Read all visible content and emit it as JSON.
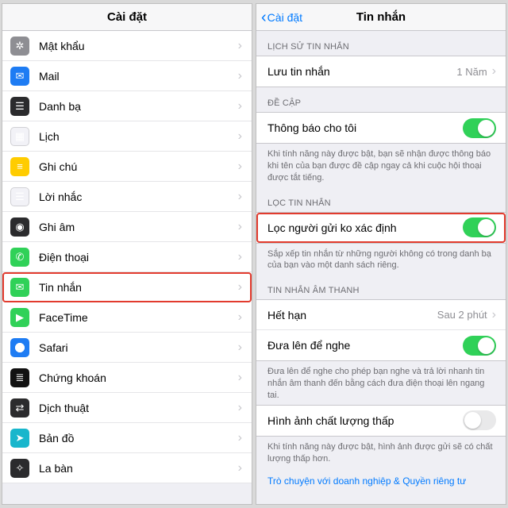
{
  "left": {
    "title": "Cài đặt",
    "items": [
      {
        "label": "Mật khẩu",
        "icon": "key-icon",
        "cls": "ic-gray"
      },
      {
        "label": "Mail",
        "icon": "mail-icon",
        "cls": "ic-blue"
      },
      {
        "label": "Danh bạ",
        "icon": "contacts-icon",
        "cls": "ic-dark"
      },
      {
        "label": "Lịch",
        "icon": "calendar-icon",
        "cls": "ic-white"
      },
      {
        "label": "Ghi chú",
        "icon": "notes-icon",
        "cls": "ic-yellow"
      },
      {
        "label": "Lời nhắc",
        "icon": "reminders-icon",
        "cls": "ic-white"
      },
      {
        "label": "Ghi âm",
        "icon": "voice-memos-icon",
        "cls": "ic-dark"
      },
      {
        "label": "Điện thoại",
        "icon": "phone-icon",
        "cls": "ic-green"
      },
      {
        "label": "Tin nhắn",
        "icon": "messages-icon",
        "cls": "ic-green",
        "highlight": true
      },
      {
        "label": "FaceTime",
        "icon": "facetime-icon",
        "cls": "ic-green"
      },
      {
        "label": "Safari",
        "icon": "safari-icon",
        "cls": "ic-compass"
      },
      {
        "label": "Chứng khoán",
        "icon": "stocks-icon",
        "cls": "ic-stock"
      },
      {
        "label": "Dịch thuật",
        "icon": "translate-icon",
        "cls": "ic-dark"
      },
      {
        "label": "Bản đồ",
        "icon": "maps-icon",
        "cls": "ic-teal"
      },
      {
        "label": "La bàn",
        "icon": "compass-icon",
        "cls": "ic-dark"
      }
    ]
  },
  "right": {
    "back": "Cài đặt",
    "title": "Tin nhắn",
    "history_header": "LỊCH SỬ TIN NHẮN",
    "keep_label": "Lưu tin nhắn",
    "keep_value": "1 Năm",
    "mention_header": "ĐỀ CẬP",
    "notify_label": "Thông báo cho tôi",
    "notify_footer": "Khi tính năng này được bật, bạn sẽ nhận được thông báo khi tên của bạn được đề cập ngay cả khi cuộc hội thoại được tắt tiếng.",
    "filter_header": "LỌC TIN NHẮN",
    "filter_label": "Lọc người gửi ko xác định",
    "filter_footer": "Sắp xếp tin nhắn từ những người không có trong danh bạ của bạn vào một danh sách riêng.",
    "audio_header": "TIN NHẮN ÂM THANH",
    "expire_label": "Hết hạn",
    "expire_value": "Sau 2 phút",
    "raise_label": "Đưa lên để nghe",
    "raise_footer": "Đưa lên để nghe cho phép bạn nghe và trả lời nhanh tin nhắn âm thanh đến bằng cách đưa điện thoại lên ngang tai.",
    "lowq_label": "Hình ảnh chất lượng thấp",
    "lowq_footer": "Khi tính năng này được bật, hình ảnh được gửi sẽ có chất lượng thấp hơn.",
    "biz_link": "Trò chuyện với doanh nghiệp & Quyền riêng tư"
  }
}
